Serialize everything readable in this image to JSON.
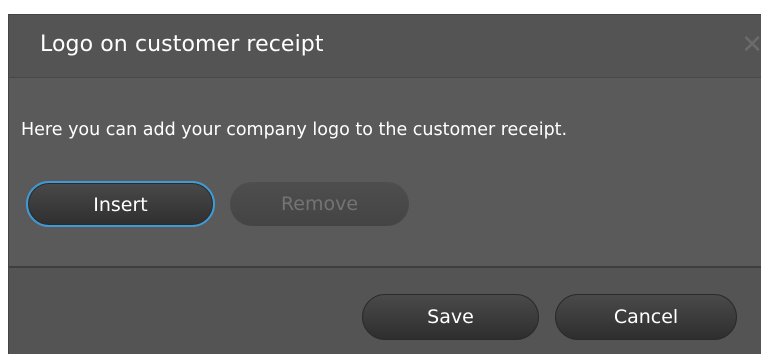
{
  "dialog": {
    "title": "Logo on customer receipt",
    "close_icon": "close-icon",
    "close_glyph": "✕",
    "message": "Here you can add your company logo to the customer receipt.",
    "buttons": {
      "insert_label": "Insert",
      "remove_label": "Remove",
      "save_label": "Save",
      "cancel_label": "Cancel"
    },
    "colors": {
      "background": "#545454",
      "content_background": "#5a5a5a",
      "focus_ring": "#3f9ad6",
      "disabled_text": "#747474"
    }
  }
}
